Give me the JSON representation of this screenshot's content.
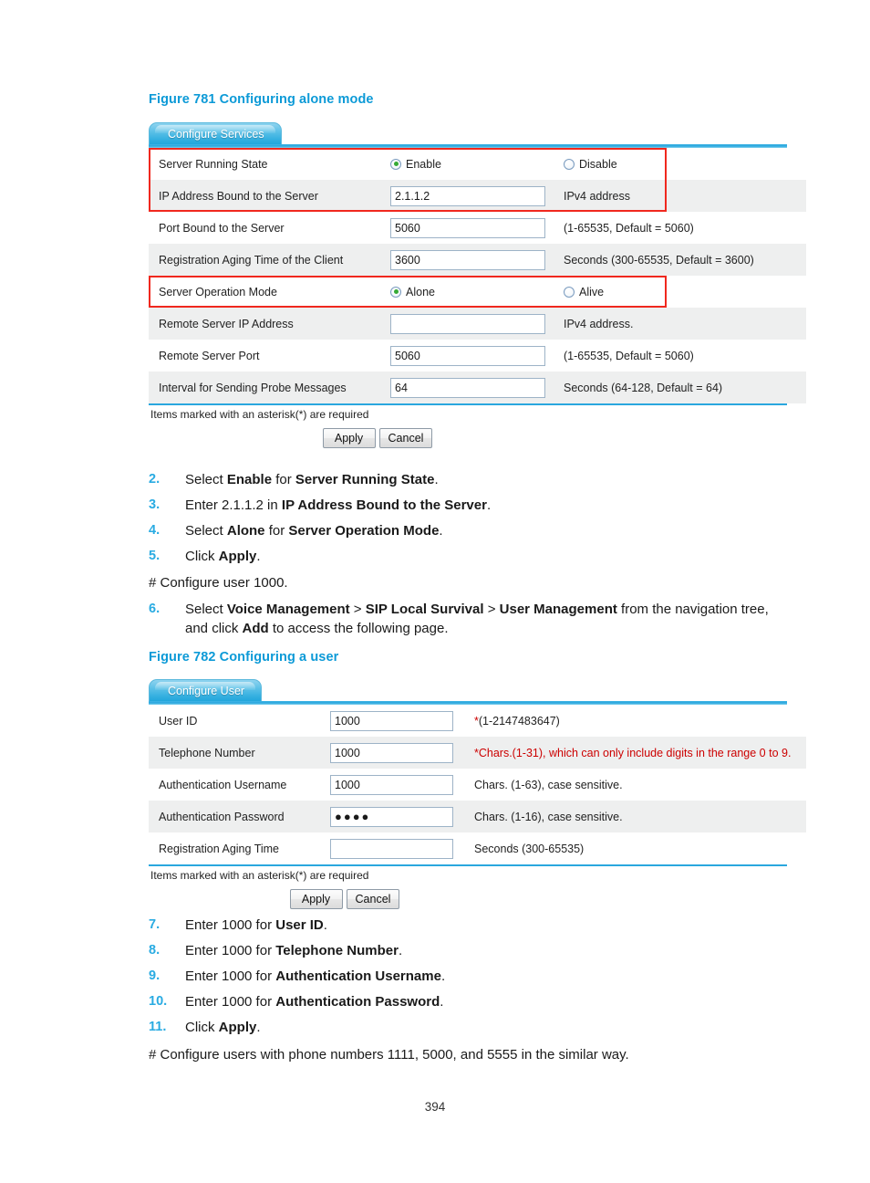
{
  "page": {
    "number": "394"
  },
  "figure1": {
    "caption": "Figure 781 Configuring alone mode",
    "tab_label": "Configure Services",
    "rows": [
      {
        "label": "Server Running State",
        "type": "radio",
        "options": [
          {
            "label": "Enable",
            "selected": true
          },
          {
            "label": "Disable",
            "selected": false
          }
        ],
        "hint": ""
      },
      {
        "label": "IP Address Bound to the Server",
        "type": "text",
        "value": "2.1.1.2",
        "hint": "IPv4 address"
      },
      {
        "label": "Port Bound to the Server",
        "type": "text",
        "value": "5060",
        "hint": "(1-65535, Default = 5060)"
      },
      {
        "label": "Registration Aging Time of the Client",
        "type": "text",
        "value": "3600",
        "hint": "Seconds (300-65535, Default = 3600)"
      },
      {
        "label": "Server Operation Mode",
        "type": "radio",
        "options": [
          {
            "label": "Alone",
            "selected": true
          },
          {
            "label": "Alive",
            "selected": false
          }
        ],
        "hint": ""
      },
      {
        "label": "Remote Server IP Address",
        "type": "text",
        "value": "",
        "hint": "IPv4 address."
      },
      {
        "label": "Remote Server Port",
        "type": "text",
        "value": "5060",
        "hint": "(1-65535, Default = 5060)"
      },
      {
        "label": "Interval for Sending Probe Messages",
        "type": "text",
        "value": "64",
        "hint": "Seconds (64-128, Default = 64)"
      }
    ],
    "required_note": "Items marked with an asterisk(*) are required",
    "apply_label": "Apply",
    "cancel_label": "Cancel"
  },
  "figure2": {
    "caption": "Figure 782 Configuring a user",
    "tab_label": "Configure User",
    "rows": [
      {
        "label": "User ID",
        "value": "1000",
        "hint_star": "*",
        "hint": "(1-2147483647)",
        "hint_all_red": false
      },
      {
        "label": "Telephone Number",
        "value": "1000",
        "hint_star": "*",
        "hint": "Chars.(1-31), which can only include digits in the range 0 to 9.",
        "hint_all_red": true
      },
      {
        "label": "Authentication Username",
        "value": "1000",
        "hint_star": "",
        "hint": "Chars. (1-63), case sensitive.",
        "hint_all_red": false
      },
      {
        "label": "Authentication Password",
        "value": "●●●●",
        "hint_star": "",
        "hint": "Chars. (1-16), case sensitive.",
        "hint_all_red": false
      },
      {
        "label": "Registration Aging Time",
        "value": "",
        "hint_star": "",
        "hint": "Seconds (300-65535)",
        "hint_all_red": false
      }
    ],
    "required_note": "Items marked with an asterisk(*) are required",
    "apply_label": "Apply",
    "cancel_label": "Cancel"
  },
  "steps_block_1": [
    {
      "num": "2.",
      "parts": [
        {
          "t": "Select ",
          "b": false
        },
        {
          "t": "Enable",
          "b": true
        },
        {
          "t": " for ",
          "b": false
        },
        {
          "t": "Server Running State",
          "b": true
        },
        {
          "t": ".",
          "b": false
        }
      ]
    },
    {
      "num": "3.",
      "parts": [
        {
          "t": "Enter 2.1.1.2 in ",
          "b": false
        },
        {
          "t": "IP Address Bound to the Server",
          "b": true
        },
        {
          "t": ".",
          "b": false
        }
      ]
    },
    {
      "num": "4.",
      "parts": [
        {
          "t": "Select ",
          "b": false
        },
        {
          "t": "Alone",
          "b": true
        },
        {
          "t": " for ",
          "b": false
        },
        {
          "t": "Server Operation Mode",
          "b": true
        },
        {
          "t": ".",
          "b": false
        }
      ]
    },
    {
      "num": "5.",
      "parts": [
        {
          "t": "Click ",
          "b": false
        },
        {
          "t": "Apply",
          "b": true
        },
        {
          "t": ".",
          "b": false
        }
      ]
    }
  ],
  "para_1": "# Configure user 1000.",
  "steps_block_2": [
    {
      "num": "6.",
      "parts": [
        {
          "t": "Select ",
          "b": false
        },
        {
          "t": "Voice Management",
          "b": true
        },
        {
          "t": " > ",
          "b": false
        },
        {
          "t": "SIP Local Survival",
          "b": true
        },
        {
          "t": " > ",
          "b": false
        },
        {
          "t": "User Management",
          "b": true
        },
        {
          "t": " from the navigation tree, and click ",
          "b": false
        },
        {
          "t": "Add",
          "b": true
        },
        {
          "t": " to access the following page.",
          "b": false
        }
      ]
    }
  ],
  "steps_block_3": [
    {
      "num": "7.",
      "parts": [
        {
          "t": "Enter 1000 for ",
          "b": false
        },
        {
          "t": "User ID",
          "b": true
        },
        {
          "t": ".",
          "b": false
        }
      ]
    },
    {
      "num": "8.",
      "parts": [
        {
          "t": "Enter 1000 for ",
          "b": false
        },
        {
          "t": "Telephone Number",
          "b": true
        },
        {
          "t": ".",
          "b": false
        }
      ]
    },
    {
      "num": "9.",
      "parts": [
        {
          "t": "Enter 1000 for ",
          "b": false
        },
        {
          "t": "Authentication Username",
          "b": true
        },
        {
          "t": ".",
          "b": false
        }
      ]
    },
    {
      "num": "10.",
      "parts": [
        {
          "t": "Enter 1000 for ",
          "b": false
        },
        {
          "t": "Authentication Password",
          "b": true
        },
        {
          "t": ".",
          "b": false
        }
      ]
    },
    {
      "num": "11.",
      "parts": [
        {
          "t": "Click ",
          "b": false
        },
        {
          "t": "Apply",
          "b": true
        },
        {
          "t": ".",
          "b": false
        }
      ]
    }
  ],
  "para_2": "# Configure users with phone numbers 1111, 5000, and 5555 in the similar way.",
  "colors": {
    "caption": "#0c9ad7",
    "step_number": "#29abe2",
    "highlight_border": "#f0281e",
    "row_alt_bg": "#eeefef",
    "tab_blue": "#2aa7de",
    "required_red": "#cc0000",
    "radio_dot_green": "#35aa35"
  }
}
